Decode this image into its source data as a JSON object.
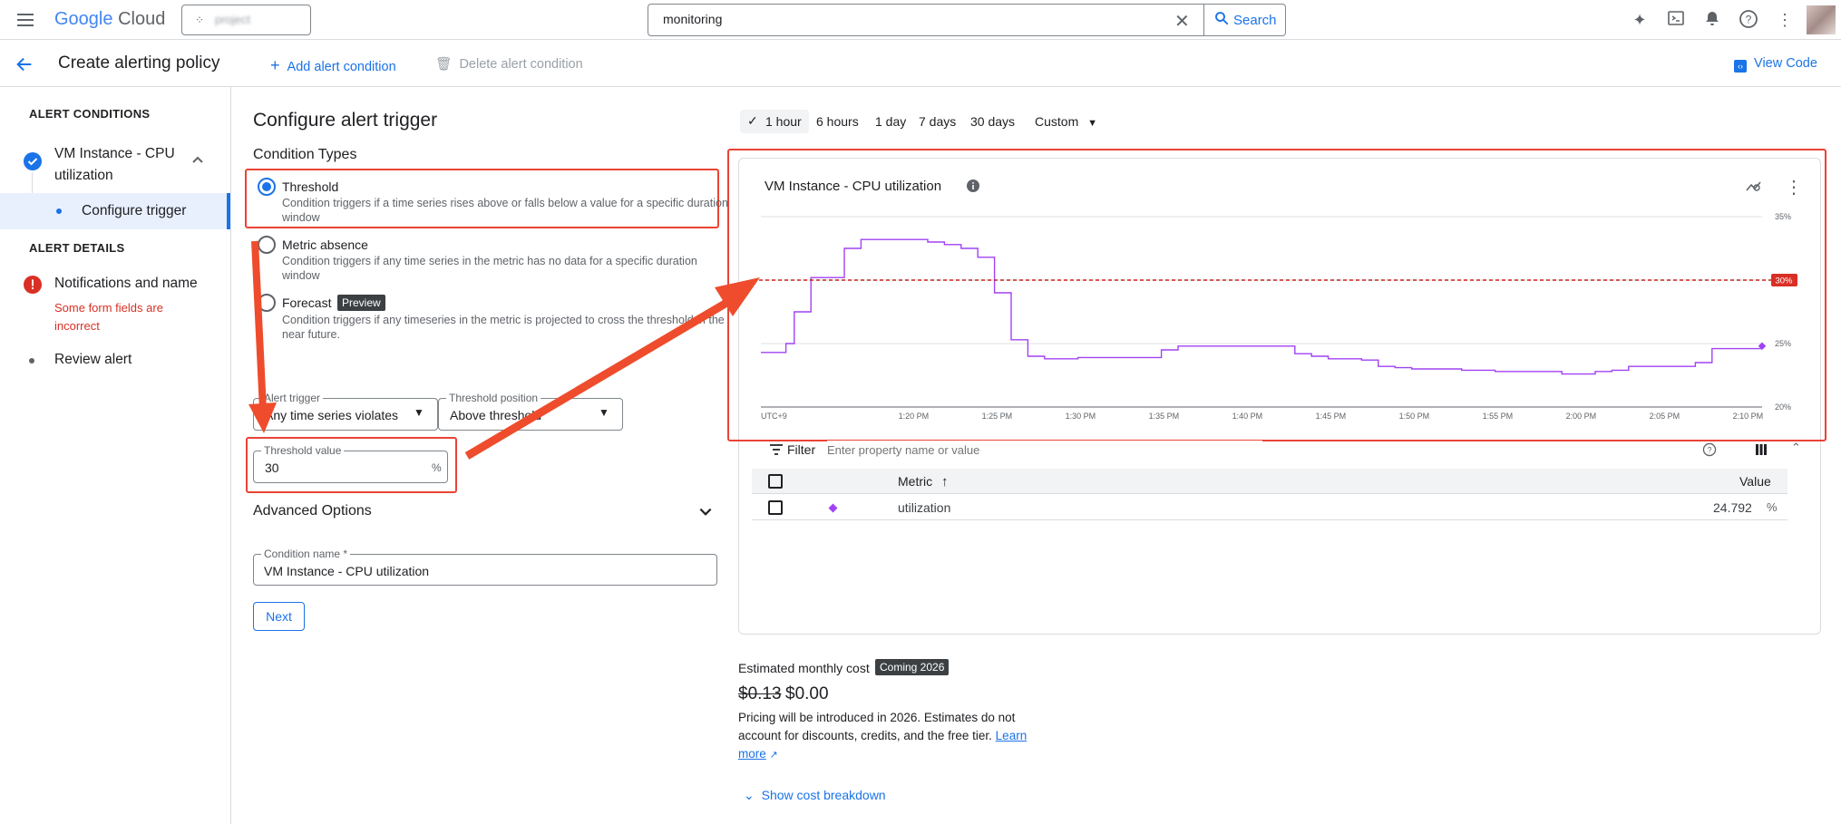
{
  "topbar": {
    "brand_google": "Google",
    "brand_cloud": "Cloud",
    "project": "project",
    "search_value": "monitoring",
    "search_label": "Search"
  },
  "subbar": {
    "title": "Create alerting policy",
    "add_condition": "Add alert condition",
    "delete_condition": "Delete alert condition",
    "view_code": "View Code"
  },
  "sidebar": {
    "alert_conditions": "ALERT CONDITIONS",
    "condition_name_l1": "VM Instance - CPU",
    "condition_name_l2": "utilization",
    "configure_trigger": "Configure trigger",
    "alert_details": "ALERT DETAILS",
    "notifications": "Notifications and name",
    "error_l1": "Some form fields are",
    "error_l2": "incorrect",
    "review": "Review alert"
  },
  "form": {
    "heading": "Configure alert trigger",
    "condition_types": "Condition Types",
    "types": [
      {
        "label": "Threshold",
        "desc_l1": "Condition triggers if a time series rises above or falls below a value for a specific duration",
        "desc_l2": "window"
      },
      {
        "label": "Metric absence",
        "desc_l1": "Condition triggers if any time series in the metric has no data for a specific duration",
        "desc_l2": "window"
      },
      {
        "label": "Forecast",
        "badge": "Preview",
        "desc_l1": "Condition triggers if any timeseries in the metric is projected to cross the threshold in the",
        "desc_l2": "near future."
      }
    ],
    "alert_trigger_label": "Alert trigger",
    "alert_trigger_value": "Any time series violates",
    "threshold_position_label": "Threshold position",
    "threshold_position_value": "Above threshold",
    "threshold_value_label": "Threshold value",
    "threshold_value": "30",
    "threshold_unit": "%",
    "advanced": "Advanced Options",
    "condition_name_label": "Condition name *",
    "condition_name_value": "VM Instance - CPU utilization",
    "next": "Next"
  },
  "time_range": {
    "options": [
      "1 hour",
      "6 hours",
      "1 day",
      "7 days",
      "30 days",
      "Custom"
    ],
    "selected": "1 hour"
  },
  "chart": {
    "title": "VM Instance - CPU utilization",
    "threshold_label": "30%",
    "colors": {
      "series": "#a142f4",
      "threshold": "#c5221f"
    }
  },
  "chart_data": {
    "type": "line",
    "title": "VM Instance - CPU utilization",
    "xlabel": "",
    "ylabel": "",
    "x_ticks": [
      "UTC+9",
      "1:20 PM",
      "1:25 PM",
      "1:30 PM",
      "1:35 PM",
      "1:40 PM",
      "1:45 PM",
      "1:50 PM",
      "1:55 PM",
      "2:00 PM",
      "2:05 PM",
      "2:10 PM"
    ],
    "y_ticks": [
      "20%",
      "25%",
      "35%"
    ],
    "ylim": [
      20,
      35
    ],
    "xlim": [
      0,
      60
    ],
    "threshold": 30,
    "series": [
      {
        "name": "utilization",
        "x": [
          0,
          1,
          1.5,
          2,
          3,
          5,
          6,
          7,
          8,
          9,
          10,
          11,
          12,
          13,
          14,
          15,
          16,
          17,
          18,
          19,
          20,
          21,
          22,
          23,
          24,
          25,
          26,
          27,
          28,
          29,
          30,
          31,
          32,
          33,
          34,
          35,
          36,
          37,
          38,
          39,
          40,
          41,
          42,
          43,
          44,
          45,
          46,
          47,
          48,
          49,
          50,
          51,
          52,
          53,
          54,
          55,
          56,
          57,
          58,
          59,
          60
        ],
        "y": [
          24.3,
          24.3,
          25.0,
          27.5,
          30.2,
          32.5,
          33.2,
          33.2,
          33.2,
          33.2,
          33.0,
          32.8,
          32.5,
          31.8,
          29.0,
          25.3,
          24.0,
          23.8,
          23.8,
          23.9,
          23.9,
          23.9,
          23.9,
          23.9,
          24.5,
          24.8,
          24.8,
          24.8,
          24.8,
          24.8,
          24.8,
          24.8,
          24.2,
          24.0,
          23.8,
          23.8,
          23.7,
          23.2,
          23.1,
          23.0,
          23.0,
          23.0,
          22.9,
          22.9,
          22.8,
          22.8,
          22.8,
          22.8,
          22.6,
          22.6,
          22.8,
          22.9,
          23.2,
          23.2,
          23.2,
          23.2,
          23.5,
          24.6,
          24.6,
          24.6,
          24.8
        ]
      }
    ]
  },
  "filter": {
    "label": "Filter",
    "placeholder": "Enter property name or value"
  },
  "table": {
    "col_metric": "Metric",
    "col_value": "Value",
    "rows": [
      {
        "metric": "utilization",
        "value": "24.792",
        "unit": "%"
      }
    ]
  },
  "cost": {
    "label": "Estimated monthly cost",
    "badge": "Coming 2026",
    "old_price": "$0.13",
    "new_price": "$0.00",
    "note_l1": "Pricing will be introduced in 2026. Estimates do not",
    "note_l2": "account for discounts, credits, and the free tier.",
    "learn": "Learn",
    "more": "more",
    "breakdown": "Show cost breakdown"
  }
}
